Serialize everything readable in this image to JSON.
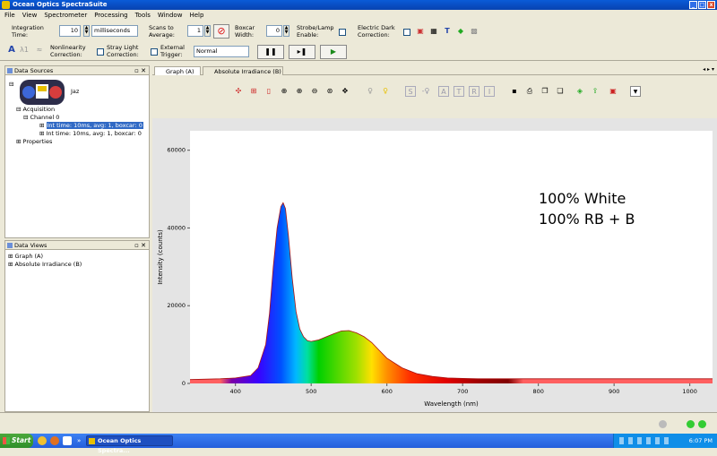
{
  "window": {
    "title": "Ocean Optics SpectraSuite",
    "minimize": "_",
    "maximize": "□",
    "close": "x"
  },
  "menu": [
    "File",
    "View",
    "Spectrometer",
    "Processing",
    "Tools",
    "Window",
    "Help"
  ],
  "toolbar": {
    "integration_label": "Integration\nTime:",
    "integration_value": "10",
    "integration_unit": "milliseconds",
    "scans_label": "Scans to\nAverage:",
    "scans_value": "1",
    "boxcar_label": "Boxcar\nWidth:",
    "boxcar_value": "0",
    "strobe_label": "Strobe/Lamp\nEnable:",
    "electric_dark_label": "Electric Dark\nCorrection:",
    "nonlinearity_label": "Nonlinearity\nCorrection:",
    "stray_light_label": "Stray Light\nCorrection:",
    "external_trigger_label": "External\nTrigger:",
    "trigger_mode": "Normal"
  },
  "data_sources": {
    "title": "Data Sources",
    "device": "Jaz",
    "acquisition": "Acquisition",
    "channel": "Channel 0",
    "item1": "Int time: 10ms, avg: 1, boxcar: 0",
    "item2": "Int time: 10ms, avg: 1, boxcar: 0",
    "properties": "Properties"
  },
  "data_views": {
    "title": "Data Views",
    "item1": "Graph (A)",
    "item2": "Absolute Irradiance (B)"
  },
  "tabs": [
    "Graph (A)",
    "Absolute Irradiance (B)"
  ],
  "graph_toolbar": {
    "s": "S",
    "a": "A",
    "t": "T",
    "r": "R",
    "i": "I"
  },
  "chart_data": {
    "type": "area",
    "xlabel": "Wavelength (nm)",
    "ylabel": "Intensity (counts)",
    "xlim": [
      340,
      1030
    ],
    "ylim": [
      0,
      65000
    ],
    "xticks": [
      400,
      500,
      600,
      700,
      800,
      900,
      1000
    ],
    "yticks": [
      0,
      20000,
      40000,
      60000
    ],
    "annotation": [
      "100% White",
      "100% RB + B"
    ],
    "x": [
      340,
      380,
      400,
      420,
      430,
      440,
      445,
      450,
      455,
      460,
      463,
      466,
      470,
      475,
      480,
      485,
      490,
      495,
      500,
      510,
      520,
      530,
      540,
      550,
      560,
      570,
      580,
      590,
      600,
      620,
      640,
      660,
      680,
      700,
      720,
      740,
      760,
      780,
      800,
      850,
      900,
      950,
      1000,
      1030
    ],
    "y": [
      1000,
      1200,
      1400,
      2000,
      4000,
      10000,
      18000,
      30000,
      40000,
      45500,
      46500,
      45000,
      38000,
      27000,
      18500,
      14000,
      12000,
      11000,
      10800,
      11200,
      12000,
      12800,
      13500,
      13600,
      13000,
      12000,
      10500,
      8500,
      6500,
      4000,
      2500,
      1800,
      1400,
      1300,
      1200,
      1200,
      1200,
      1200,
      1200,
      1200,
      1200,
      1200,
      1200,
      1200
    ]
  },
  "taskbar": {
    "start": "Start",
    "task": "Ocean Optics Spectra...",
    "time": "6:07 PM"
  }
}
